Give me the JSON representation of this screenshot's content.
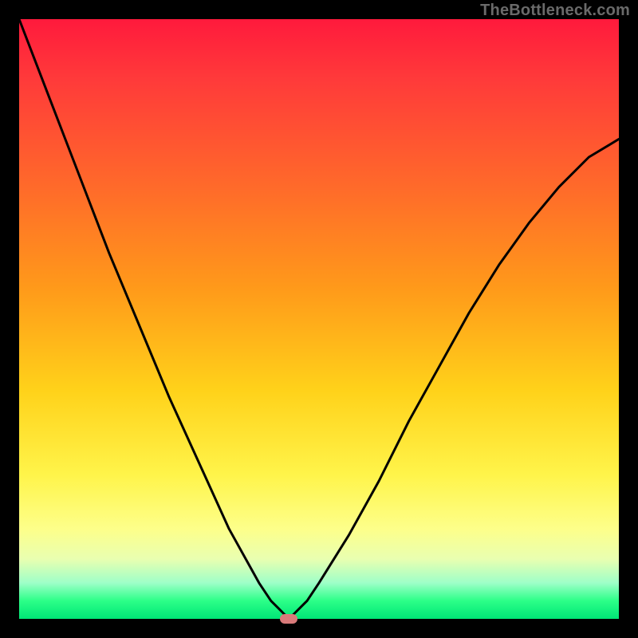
{
  "watermark": "TheBottleneck.com",
  "colors": {
    "frame": "#000000",
    "curve": "#000000",
    "marker": "#d97a7a",
    "gradient_top": "#ff1a3c",
    "gradient_bottom": "#00e676"
  },
  "chart_data": {
    "type": "line",
    "title": "",
    "xlabel": "",
    "ylabel": "",
    "xlim": [
      0,
      100
    ],
    "ylim": [
      0,
      100
    ],
    "grid": false,
    "legend": false,
    "series": [
      {
        "name": "bottleneck-curve",
        "x": [
          0,
          5,
          10,
          15,
          20,
          25,
          30,
          35,
          40,
          42,
          44,
          45,
          46,
          48,
          50,
          55,
          60,
          65,
          70,
          75,
          80,
          85,
          90,
          95,
          100
        ],
        "y": [
          100,
          87,
          74,
          61,
          49,
          37,
          26,
          15,
          6,
          3,
          1,
          0,
          1,
          3,
          6,
          14,
          23,
          33,
          42,
          51,
          59,
          66,
          72,
          77,
          80
        ]
      }
    ],
    "minimum": {
      "x": 45,
      "y": 0
    },
    "note": "axes and ticks not shown in source image; values estimated from curve shape"
  }
}
